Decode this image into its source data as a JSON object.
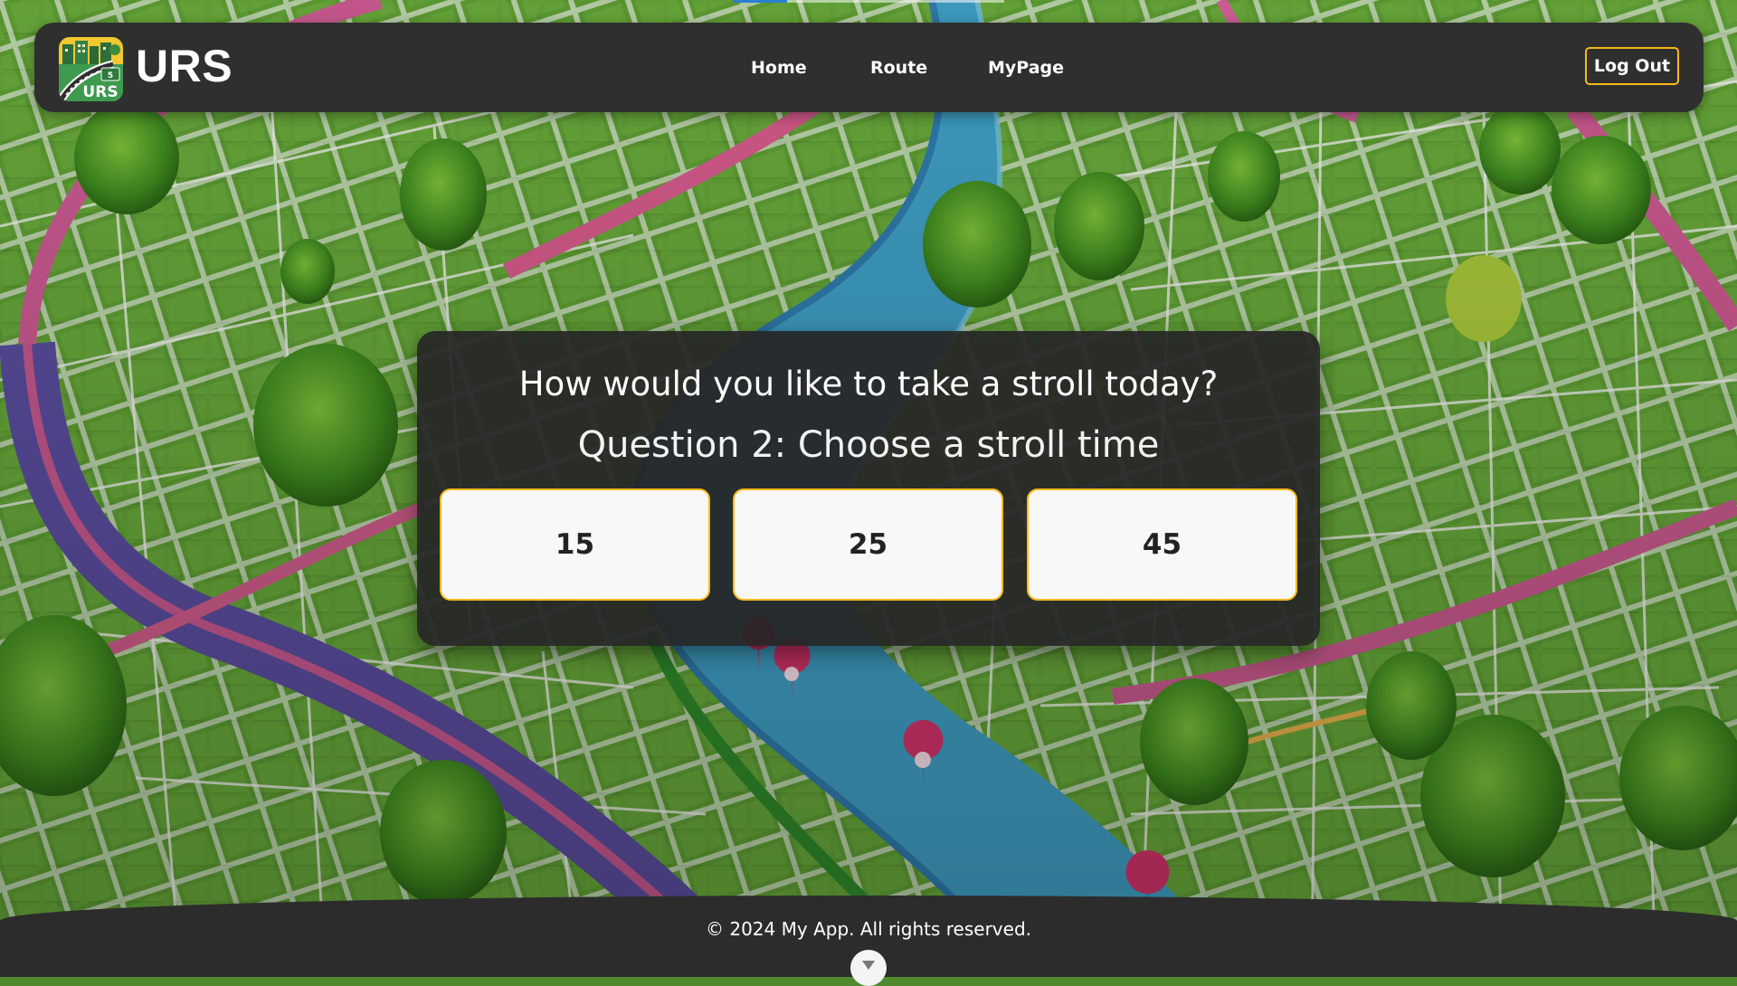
{
  "header": {
    "brand": "URS",
    "nav": [
      {
        "label": "Home"
      },
      {
        "label": "Route"
      },
      {
        "label": "MyPage"
      }
    ],
    "logout_label": "Log Out",
    "logo": {
      "icon": "urs-city-road-logo",
      "text": "URS",
      "sign_text": "5"
    }
  },
  "card": {
    "title": "How would you like to take a stroll today?",
    "question": "Question 2: Choose a stroll time",
    "options": [
      {
        "label": "15"
      },
      {
        "label": "25"
      },
      {
        "label": "45"
      }
    ]
  },
  "footer": {
    "text": "© 2024 My App. All rights reserved.",
    "scroll_icon": "chevron-down-icon"
  },
  "colors": {
    "accent": "#f5b91a",
    "header_bg": "#2f2f2f",
    "card_bg": "#262626",
    "option_bg": "#f8f8f8",
    "river": "#3f9fc4",
    "grass": "#5d9a33"
  }
}
